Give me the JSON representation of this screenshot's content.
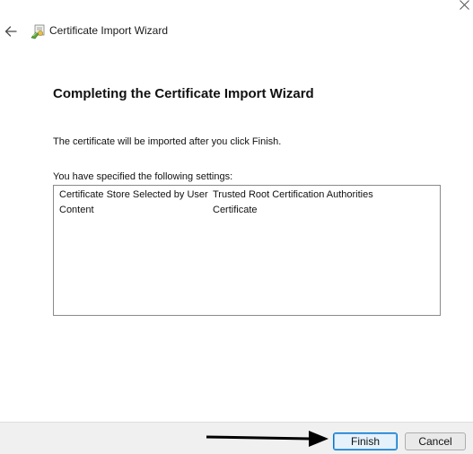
{
  "window": {
    "title": "Certificate Import Wizard"
  },
  "icons": {
    "close": "close-icon",
    "back": "back-arrow-icon",
    "wizard": "certificate-wizard-icon",
    "annotation": "annotation-arrow-icon"
  },
  "page": {
    "heading": "Completing the Certificate Import Wizard",
    "info_text": "The certificate will be imported after you click Finish.",
    "settings_label": "You have specified the following settings:"
  },
  "settings": [
    {
      "key": "Certificate Store Selected by User",
      "value": "Trusted Root Certification Authorities"
    },
    {
      "key": "Content",
      "value": "Certificate"
    }
  ],
  "buttons": {
    "finish": "Finish",
    "cancel": "Cancel"
  },
  "colors": {
    "accent": "#0078d4",
    "footer_bg": "#f0f0f0"
  }
}
